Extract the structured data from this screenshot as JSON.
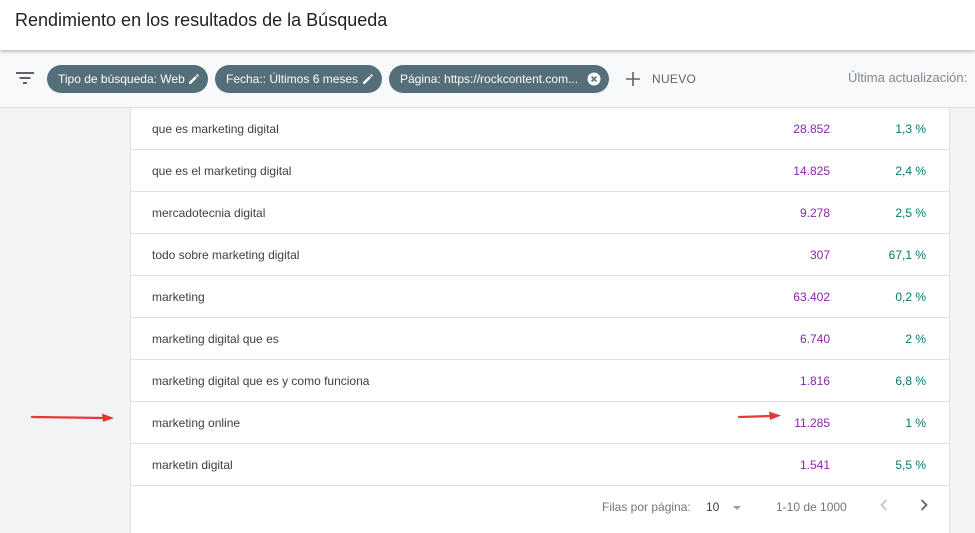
{
  "header": {
    "title": "Rendimiento en los resultados de la Búsqueda"
  },
  "filters": {
    "chips": [
      {
        "label": "Tipo de búsqueda: Web",
        "icon": "edit-icon"
      },
      {
        "label": "Fecha:: Últimos 6 meses",
        "icon": "edit-icon"
      },
      {
        "label": "Página: https://rockcontent.com...",
        "icon": "close-circle-icon"
      }
    ],
    "new_label": "NUEVO",
    "last_update": "Última actualización: "
  },
  "table": {
    "rows": [
      {
        "query": "que es marketing digital",
        "clicks": "28.852",
        "ctr": "1,3 %"
      },
      {
        "query": "que es el marketing digital",
        "clicks": "14.825",
        "ctr": "2,4 %"
      },
      {
        "query": "mercadotecnia digital",
        "clicks": "9.278",
        "ctr": "2,5 %"
      },
      {
        "query": "todo sobre marketing digital",
        "clicks": "307",
        "ctr": "67,1 %"
      },
      {
        "query": "marketing",
        "clicks": "63.402",
        "ctr": "0,2 %"
      },
      {
        "query": "marketing digital que es",
        "clicks": "6.740",
        "ctr": "2 %"
      },
      {
        "query": "marketing digital que es y como funciona",
        "clicks": "1.816",
        "ctr": "6,8 %"
      },
      {
        "query": "marketing online",
        "clicks": "11.285",
        "ctr": "1 %"
      },
      {
        "query": "marketin digital",
        "clicks": "1.541",
        "ctr": "5,5 %"
      }
    ]
  },
  "pagination": {
    "rows_per_page_label": "Filas por página:",
    "rows_per_page": "10",
    "range": "1-10 de 1000"
  },
  "colors": {
    "chip": "#546e7a",
    "clicks": "#8e24aa",
    "ctr": "#00796b",
    "annotation_arrow": "#e53935"
  }
}
